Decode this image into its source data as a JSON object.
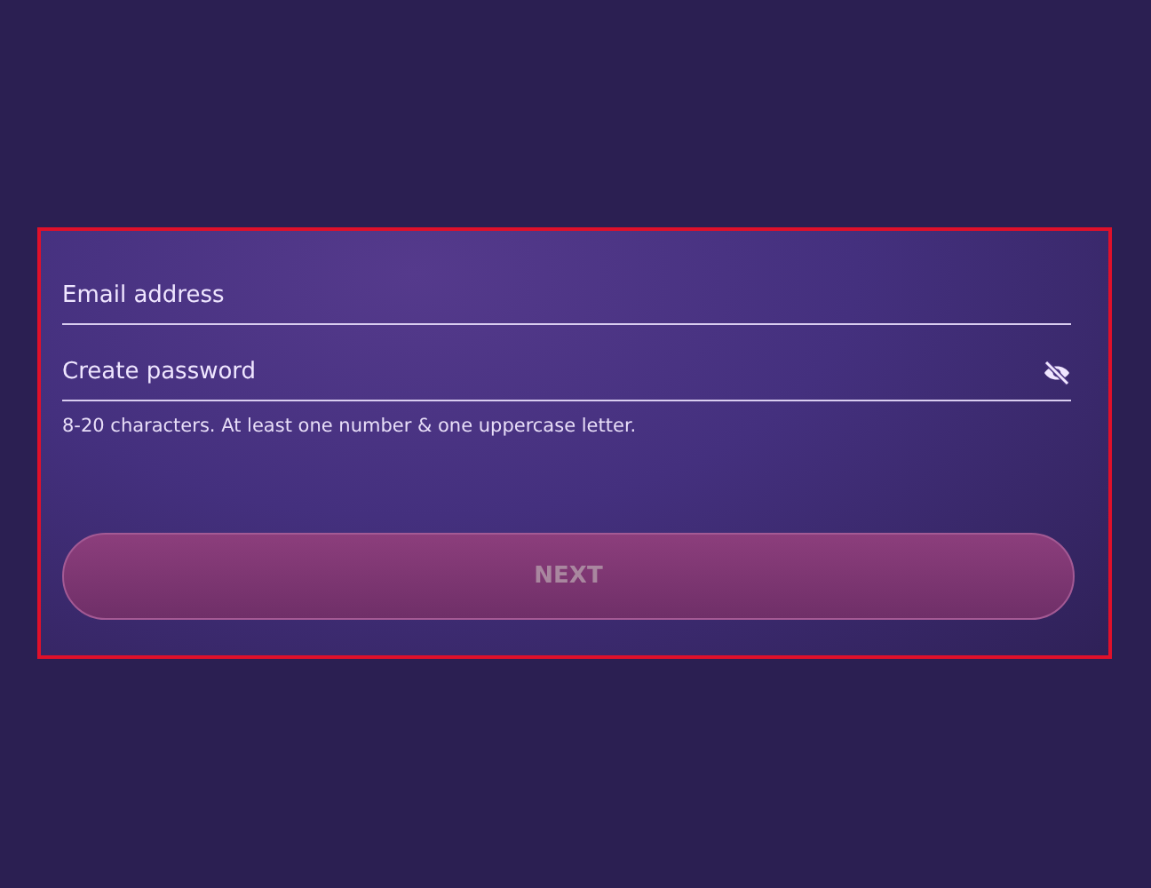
{
  "form": {
    "fields": [
      {
        "kind": "email",
        "placeholder": "Email address"
      },
      {
        "kind": "password",
        "placeholder": "Create password",
        "hint": "8-20 characters. At least one number & one uppercase letter."
      }
    ],
    "button": {
      "label": "NEXT",
      "disabled": true
    }
  }
}
